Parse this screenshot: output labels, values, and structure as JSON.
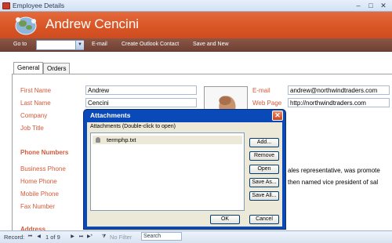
{
  "window": {
    "title": "Employee Details"
  },
  "header": {
    "name": "Andrew Cencini"
  },
  "toolbar": {
    "goto_label": "Go to",
    "email_link": "E-mail",
    "outlook_link": "Create Outlook Contact",
    "save_new_link": "Save and New"
  },
  "tabs": [
    {
      "label": "General"
    },
    {
      "label": "Orders"
    }
  ],
  "form": {
    "first_name": {
      "label": "First Name",
      "value": "Andrew"
    },
    "last_name": {
      "label": "Last Name",
      "value": "Cencini"
    },
    "company": {
      "label": "Company"
    },
    "job_title": {
      "label": "Job Title"
    },
    "phone_section": "Phone Numbers",
    "business_phone": {
      "label": "Business Phone"
    },
    "home_phone": {
      "label": "Home Phone"
    },
    "mobile_phone": {
      "label": "Mobile Phone"
    },
    "fax_number": {
      "label": "Fax Number"
    },
    "address_section": "Address",
    "email": {
      "label": "E-mail",
      "value": "andrew@northwindtraders.com"
    },
    "web_page": {
      "label": "Web Page",
      "value": "http://northwindtraders.com"
    },
    "notes_line1": "ales representative, was promote",
    "notes_line2": "then named vice president of sal"
  },
  "dialog": {
    "title": "Attachments",
    "hint": "Attachments (Double-click to open)",
    "items": [
      {
        "name": "termphp.txt"
      }
    ],
    "buttons": {
      "add": "Add...",
      "remove": "Remove",
      "open": "Open",
      "save_as": "Save As...",
      "save_all": "Save All...",
      "ok": "OK",
      "cancel": "Cancel"
    }
  },
  "status": {
    "record_label": "Record:",
    "record_pos": "1 of 9",
    "filter": "No Filter",
    "search": "Search"
  },
  "colors": {
    "header": "#d85425",
    "toolbar": "#7a4a3c",
    "label": "#d35a3a",
    "dialog_frame": "#0a49b8",
    "dialog_body": "#ece9d8"
  }
}
